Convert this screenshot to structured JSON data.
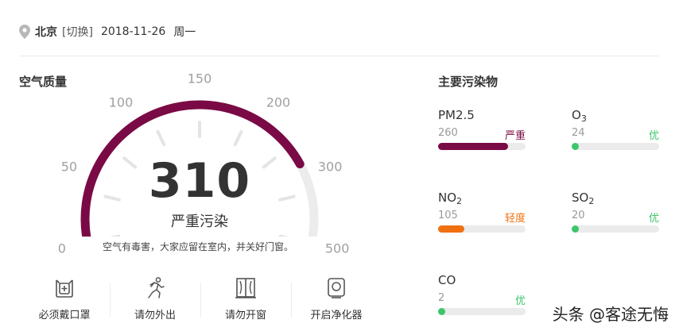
{
  "header": {
    "location_icon": "location-pin-icon",
    "city": "北京",
    "switch_label": "[切换]",
    "date": "2018-11-26",
    "weekday": "周一"
  },
  "aqi": {
    "title": "空气质量",
    "value": "310",
    "level": "严重污染",
    "advice": "空气有毒害，大家应留在室内，并关好门窗。",
    "scale_labels": [
      "0",
      "50",
      "100",
      "150",
      "200",
      "300",
      "500"
    ],
    "gauge_fraction": 0.8,
    "colors": {
      "arc": "#7a0a45",
      "track": "#ececec",
      "ticks": "#e4e4e4"
    }
  },
  "tips": [
    {
      "label": "必须戴口罩",
      "icon": "mask-icon"
    },
    {
      "label": "请勿外出",
      "icon": "running-person-icon"
    },
    {
      "label": "请勿开窗",
      "icon": "window-icon"
    },
    {
      "label": "开启净化器",
      "icon": "air-purifier-icon"
    }
  ],
  "pollutants": {
    "title": "主要污染物",
    "items": [
      {
        "name": "PM2.5",
        "sub": "",
        "value": "260",
        "level": "严重",
        "level_color": "#7a0a45",
        "bar_color": "#7a0a45",
        "fill": 0.8
      },
      {
        "name": "O",
        "sub": "3",
        "value": "24",
        "level": "优",
        "level_color": "#3cc66b",
        "bar_color": "#3cc66b",
        "fill": 0.06
      },
      {
        "name": "NO",
        "sub": "2",
        "value": "105",
        "level": "轻度",
        "level_color": "#f07010",
        "bar_color": "#f07010",
        "fill": 0.3
      },
      {
        "name": "SO",
        "sub": "2",
        "value": "20",
        "level": "优",
        "level_color": "#3cc66b",
        "bar_color": "#3cc66b",
        "fill": 0.06
      },
      {
        "name": "CO",
        "sub": "",
        "value": "2",
        "level": "优",
        "level_color": "#3cc66b",
        "bar_color": "#3cc66b",
        "fill": 0.06
      }
    ]
  },
  "watermark": "头条 @客途无悔"
}
